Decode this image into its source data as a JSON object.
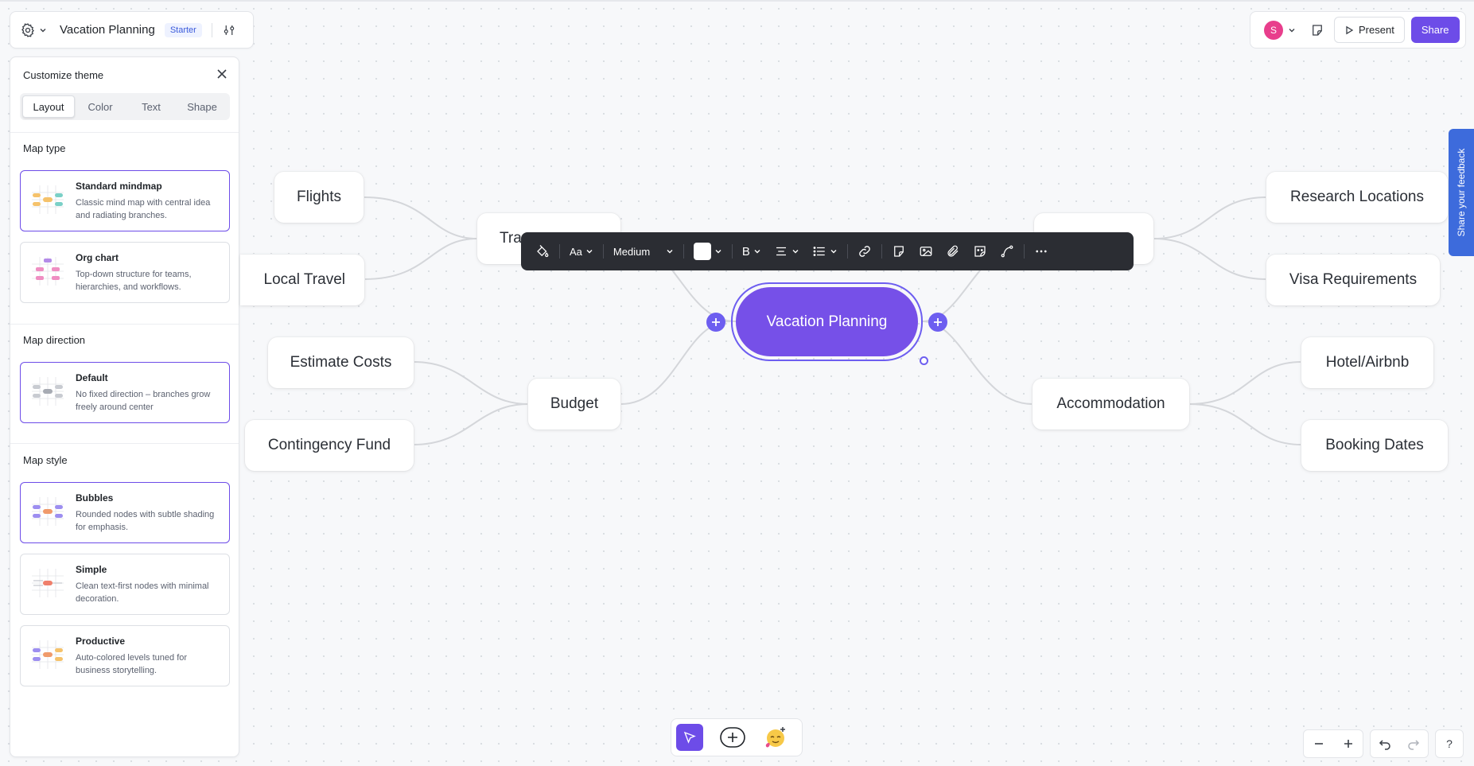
{
  "header": {
    "doc_title": "Vacation Planning",
    "plan_badge": "Starter"
  },
  "topbar_right": {
    "avatar_initial": "S",
    "present_label": "Present",
    "share_label": "Share"
  },
  "panel": {
    "title": "Customize theme",
    "tabs": [
      {
        "label": "Layout",
        "active": true
      },
      {
        "label": "Color",
        "active": false
      },
      {
        "label": "Text",
        "active": false
      },
      {
        "label": "Shape",
        "active": false
      }
    ],
    "map_type": {
      "title": "Map type",
      "options": [
        {
          "title": "Standard mindmap",
          "desc": "Classic mind map with central idea and radiating branches.",
          "selected": true
        },
        {
          "title": "Org chart",
          "desc": "Top-down structure for teams, hierarchies, and workflows.",
          "selected": false
        }
      ]
    },
    "map_direction": {
      "title": "Map direction",
      "options": [
        {
          "title": "Default",
          "desc": "No fixed direction – branches grow freely around center",
          "selected": true
        }
      ]
    },
    "map_style": {
      "title": "Map style",
      "options": [
        {
          "title": "Bubbles",
          "desc": "Rounded nodes with subtle shading for emphasis.",
          "selected": true
        },
        {
          "title": "Simple",
          "desc": "Clean text-first nodes with minimal decoration.",
          "selected": false
        },
        {
          "title": "Productive",
          "desc": "Auto-colored levels tuned for business storytelling.",
          "selected": false
        }
      ]
    }
  },
  "mindmap": {
    "central": "Vacation Planning",
    "nodes": {
      "flights": "Flights",
      "local_travel": "Local Travel",
      "travel_partial": "Tra",
      "estimate_costs": "Estimate Costs",
      "contingency_fund": "Contingency Fund",
      "budget": "Budget",
      "research_locations": "Research Locations",
      "visa_requirements": "Visa Requirements",
      "accommodation": "Accommodation",
      "hotel_airbnb": "Hotel/Airbnb",
      "booking_dates": "Booking Dates"
    }
  },
  "format_toolbar": {
    "font_label": "Aa",
    "size_label": "Medium",
    "bold_label": "B",
    "fill_color": "#ffffff"
  },
  "feedback": {
    "label": "Share your feedback"
  },
  "bottom": {
    "help_label": "?"
  },
  "colors": {
    "accent": "#6d4ce8",
    "central_fill": "#7650e8",
    "toolbar_bg": "#2b2d33",
    "feedback_bg": "#3d6bdc"
  }
}
